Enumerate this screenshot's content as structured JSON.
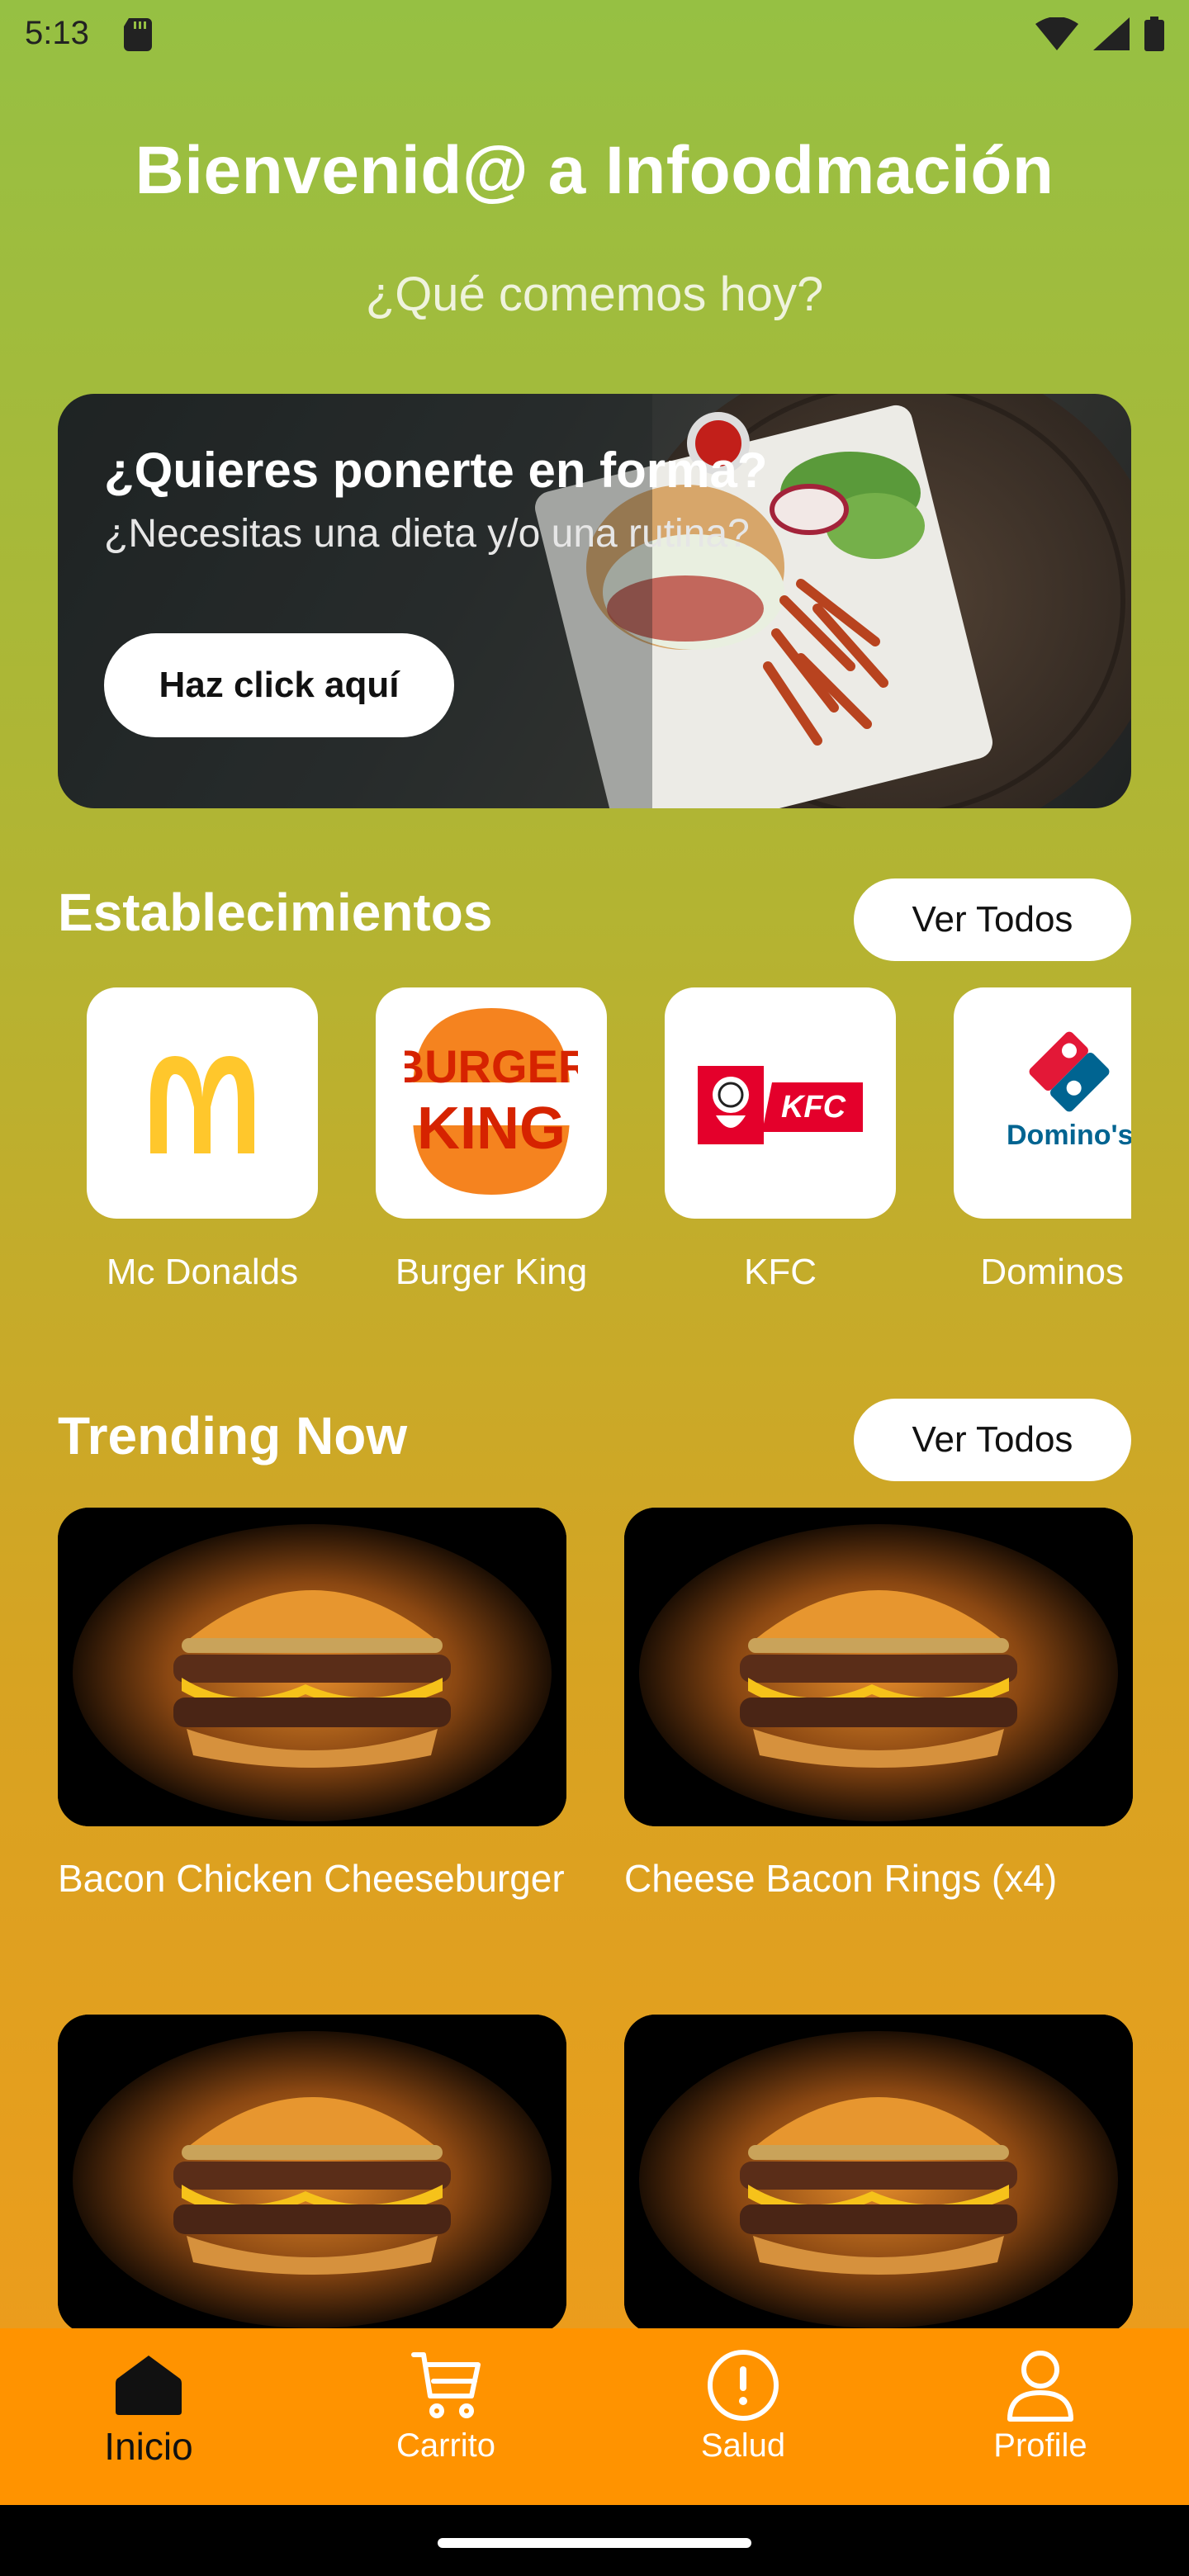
{
  "status": {
    "time": "5:13"
  },
  "header": {
    "title": "Bienvenid@ a Infoodmación",
    "subtitle": "¿Qué comemos hoy?"
  },
  "banner": {
    "title": "¿Quieres ponerte en forma?",
    "subtitle": "¿Necesitas una dieta y/o una rutina?",
    "button_label": "Haz click aquí"
  },
  "establishments": {
    "title": "Establecimientos",
    "see_all": "Ver Todos",
    "items": [
      {
        "name": "Mc Donalds",
        "logo": "mcdonalds-logo"
      },
      {
        "name": "Burger King",
        "logo": "burger-king-logo",
        "logo_text_1": "BURGER",
        "logo_text_2": "KING"
      },
      {
        "name": "KFC",
        "logo": "kfc-logo",
        "logo_text": "KFC"
      },
      {
        "name": "Dominos P",
        "logo": "dominos-logo",
        "logo_text": "Domino's"
      }
    ]
  },
  "trending": {
    "title": "Trending Now",
    "see_all": "Ver Todos",
    "items": [
      {
        "name": "Bacon Chicken Cheeseburger"
      },
      {
        "name": "Cheese Bacon Rings (x4)"
      },
      {
        "name": ""
      },
      {
        "name": ""
      }
    ]
  },
  "nav": {
    "items": [
      {
        "label": "Inicio",
        "icon": "home-icon",
        "active": true
      },
      {
        "label": "Carrito",
        "icon": "cart-icon",
        "active": false
      },
      {
        "label": "Salud",
        "icon": "alert-icon",
        "active": false
      },
      {
        "label": "Profile",
        "icon": "person-icon",
        "active": false
      }
    ]
  },
  "colors": {
    "gradient_top": "#96c043",
    "gradient_bottom": "#f39a1a",
    "nav_bg": "#ff9300",
    "mcd_yellow": "#ffc72c",
    "bk_red": "#d62300",
    "kfc_red": "#e4002b",
    "dominos_blue": "#006491"
  }
}
